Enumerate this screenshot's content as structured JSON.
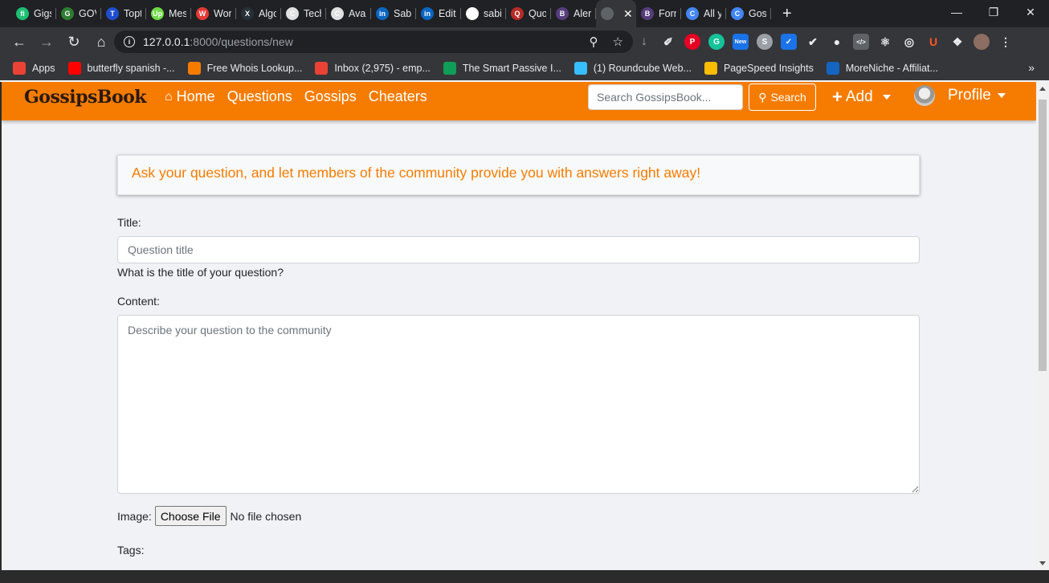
{
  "browser": {
    "tabs": [
      {
        "title": "Gigs",
        "fav_color": "#1dbf73",
        "fav_glyph": "fi"
      },
      {
        "title": "GOV",
        "fav_color": "#2e7d32",
        "fav_glyph": "G"
      },
      {
        "title": "Topt",
        "fav_color": "#204ecf",
        "fav_glyph": "T"
      },
      {
        "title": "Mes",
        "fav_color": "#6fda44",
        "fav_glyph": "Up"
      },
      {
        "title": "Wor",
        "fav_color": "#e53935",
        "fav_glyph": "W"
      },
      {
        "title": "Algo",
        "fav_color": "#263238",
        "fav_glyph": "X"
      },
      {
        "title": "Tech",
        "fav_color": "#e0e0e0",
        "fav_glyph": "C"
      },
      {
        "title": "Avai",
        "fav_color": "#e0e0e0",
        "fav_glyph": "C"
      },
      {
        "title": "Sabi",
        "fav_color": "#0a66c2",
        "fav_glyph": "in"
      },
      {
        "title": "Edit",
        "fav_color": "#0a66c2",
        "fav_glyph": "in"
      },
      {
        "title": "sabi",
        "fav_color": "#ffffff",
        "fav_glyph": "gh"
      },
      {
        "title": "Quo",
        "fav_color": "#b92b27",
        "fav_glyph": "Q"
      },
      {
        "title": "Aler",
        "fav_color": "#563d7c",
        "fav_glyph": "B"
      },
      {
        "title": "|",
        "fav_color": "#5f6368",
        "fav_glyph": "",
        "active": true
      },
      {
        "title": "Forn",
        "fav_color": "#563d7c",
        "fav_glyph": "B"
      },
      {
        "title": "All y",
        "fav_color": "#4285f4",
        "fav_glyph": "C"
      },
      {
        "title": "Goss",
        "fav_color": "#4285f4",
        "fav_glyph": "C"
      }
    ],
    "url_host": "127.0.0.1",
    "url_path": ":8000/questions/new",
    "bookmarks": [
      {
        "label": "Apps",
        "icon_color": "#ea4335"
      },
      {
        "label": "butterfly spanish -...",
        "icon_color": "#ff0000"
      },
      {
        "label": "Free Whois Lookup...",
        "icon_color": "#f57c00"
      },
      {
        "label": "Inbox (2,975) - emp...",
        "icon_color": "#ea4335"
      },
      {
        "label": "The Smart Passive I...",
        "icon_color": "#0f9d58"
      },
      {
        "label": "(1) Roundcube Web...",
        "icon_color": "#37beff"
      },
      {
        "label": "PageSpeed Insights",
        "icon_color": "#fbbc04"
      },
      {
        "label": "MoreNiche - Affiliat...",
        "icon_color": "#1565c0"
      }
    ]
  },
  "navbar": {
    "brand": "GossipsBook",
    "links": [
      "Home",
      "Questions",
      "Gossips",
      "Cheaters"
    ],
    "search_placeholder": "Search GossipsBook...",
    "search_button": "Search",
    "add_label": "Add",
    "profile_label": "Profile",
    "accent_color": "#f57c00"
  },
  "form": {
    "alert_text": "Ask your question, and let members of the community provide you with answers right away!",
    "title_label": "Title:",
    "title_placeholder": "Question title",
    "title_help": "What is the title of your question?",
    "content_label": "Content:",
    "content_placeholder": "Describe your question to the community",
    "image_label": "Image:",
    "file_button": "Choose File",
    "file_status": "No file chosen",
    "tags_label": "Tags:"
  }
}
